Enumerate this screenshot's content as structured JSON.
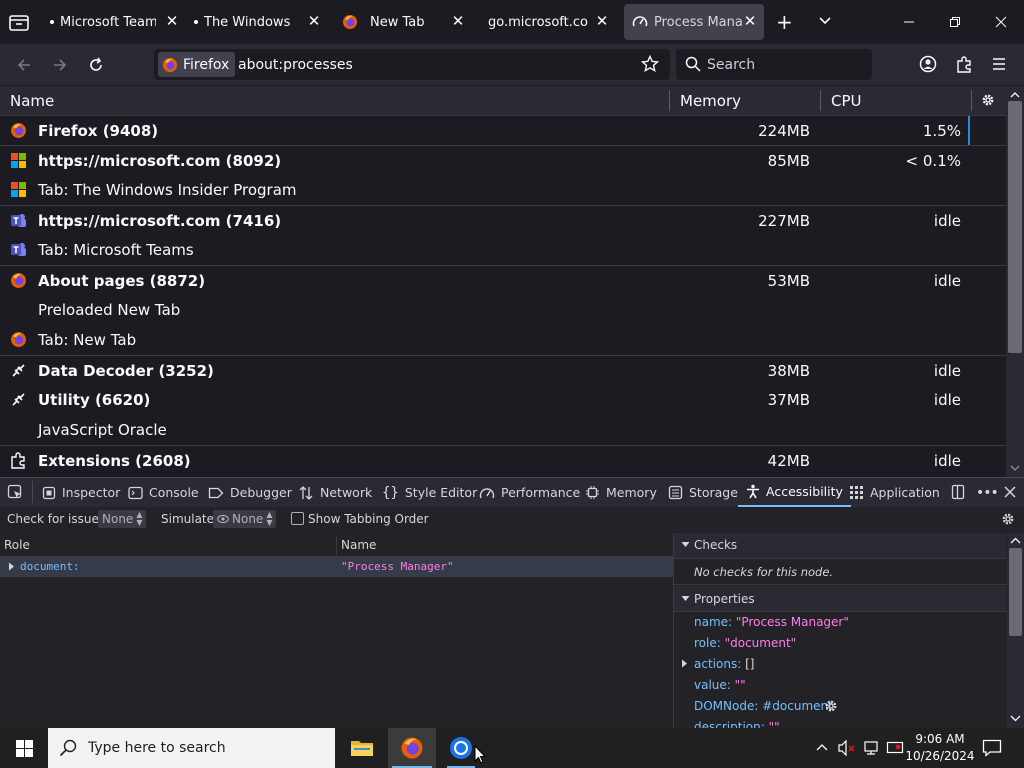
{
  "browser": {
    "tabs": [
      {
        "label": "Microsoft Teams",
        "icon": "dot-icon"
      },
      {
        "label": "The Windows In",
        "icon": "dot-icon"
      },
      {
        "label": "New Tab",
        "icon": "firefox-icon"
      },
      {
        "label": "go.microsoft.com/fw",
        "icon": "none"
      },
      {
        "label": "Process Manag",
        "icon": "speedometer-icon",
        "active": true
      }
    ],
    "identity_label": "Firefox",
    "url": "about:processes",
    "search_placeholder": "Search"
  },
  "process_table": {
    "columns": [
      "Name",
      "Memory",
      "CPU"
    ],
    "rows": [
      {
        "name": "Firefox (9408)",
        "memory": "224MB",
        "cpu": "1.5%",
        "bold": true,
        "icon": "firefox-icon"
      },
      {
        "name": "https://microsoft.com (8092)",
        "memory": "85MB",
        "cpu": "< 0.1%",
        "bold": true,
        "icon": "microsoft-logo-icon"
      },
      {
        "name": "Tab: The Windows Insider Program",
        "memory": "",
        "cpu": "",
        "bold": false,
        "icon": "microsoft-logo-icon"
      },
      {
        "name": "https://microsoft.com (7416)",
        "memory": "227MB",
        "cpu": "idle",
        "bold": true,
        "icon": "teams-icon"
      },
      {
        "name": "Tab: Microsoft Teams",
        "memory": "",
        "cpu": "",
        "bold": false,
        "icon": "teams-icon"
      },
      {
        "name": "About pages (8872)",
        "memory": "53MB",
        "cpu": "idle",
        "bold": true,
        "icon": "firefox-icon"
      },
      {
        "name": "Preloaded New Tab",
        "memory": "",
        "cpu": "",
        "bold": false,
        "icon": "none"
      },
      {
        "name": "Tab: New Tab",
        "memory": "",
        "cpu": "",
        "bold": false,
        "icon": "firefox-icon"
      },
      {
        "name": "Data Decoder (3252)",
        "memory": "38MB",
        "cpu": "idle",
        "bold": true,
        "icon": "plug-icon"
      },
      {
        "name": "Utility (6620)",
        "memory": "37MB",
        "cpu": "idle",
        "bold": true,
        "icon": "plug-icon"
      },
      {
        "name": "JavaScript Oracle",
        "memory": "",
        "cpu": "",
        "bold": false,
        "icon": "none"
      },
      {
        "name": "Extensions (2608)",
        "memory": "42MB",
        "cpu": "idle",
        "bold": true,
        "icon": "puzzle-icon"
      }
    ]
  },
  "devtools": {
    "tabs": [
      "Inspector",
      "Console",
      "Debugger",
      "Network",
      "Style Editor",
      "Performance",
      "Memory",
      "Storage",
      "Accessibility",
      "Application"
    ],
    "active_tab": "Accessibility",
    "toolbar": {
      "check_label": "Check for issues:",
      "check_value": "None",
      "simulate_label": "Simulate:",
      "simulate_value": "None",
      "tabbing_label": "Show Tabbing Order"
    },
    "tree": {
      "col_role": "Role",
      "col_name": "Name",
      "row_role": "document:",
      "row_name": "\"Process Manager\""
    },
    "sidebar": {
      "checks_title": "Checks",
      "checks_empty": "No checks for this node.",
      "properties_title": "Properties",
      "properties": [
        {
          "key": "name:",
          "value": "\"Process Manager\""
        },
        {
          "key": "role:",
          "value": "\"document\""
        },
        {
          "key": "actions:",
          "value": "[]"
        },
        {
          "key": "value:",
          "value": "\"\""
        },
        {
          "key": "DOMNode:",
          "value": "#document"
        },
        {
          "key": "description:",
          "value": "\"\""
        }
      ]
    }
  },
  "taskbar": {
    "search_placeholder": "Type here to search",
    "time": "9:06 AM",
    "date": "10/26/2024"
  },
  "colors": {
    "accent": "#75bfff",
    "cpu_bar": "#2a8bd8",
    "string_value": "#ff7de9"
  }
}
